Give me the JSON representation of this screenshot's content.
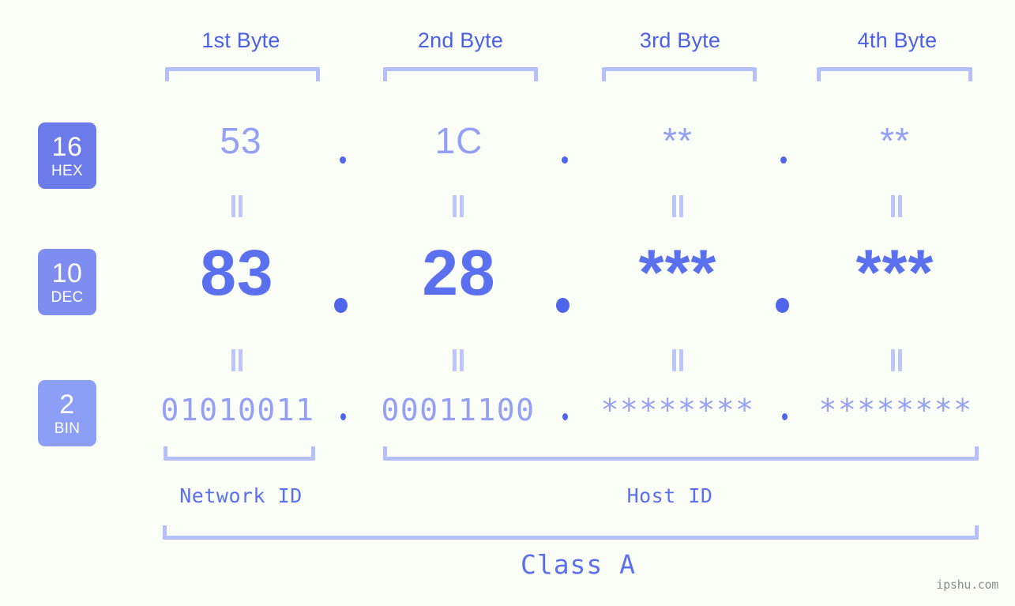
{
  "page": {
    "background_color": "#fbfdf7",
    "watermark": "ipshu.com"
  },
  "colors": {
    "header_blue": "#4b60e8",
    "bracket": "#b4bffb",
    "light_value": "#93a0f6",
    "strong_value": "#5a70ee",
    "badge_hex": "#6d7ae9",
    "badge_dec": "#808df0",
    "badge_bin": "#8c9ef5",
    "dot": "#4f66ec",
    "equals": "#bcc6fb",
    "watermark": "#8c8c8c"
  },
  "byte_headers": [
    {
      "label": "1st Byte"
    },
    {
      "label": "2nd Byte"
    },
    {
      "label": "3rd Byte"
    },
    {
      "label": "4th Byte"
    }
  ],
  "bases": [
    {
      "num": "16",
      "name": "HEX",
      "color": "#6d7ae9"
    },
    {
      "num": "10",
      "name": "DEC",
      "color": "#808df0"
    },
    {
      "num": "2",
      "name": "BIN",
      "color": "#8c9ef5"
    }
  ],
  "rows": {
    "hex": {
      "base_num": "16",
      "base_name": "HEX",
      "octets": [
        "53",
        "1C",
        "**",
        "**"
      ],
      "separator": "."
    },
    "dec": {
      "base_num": "10",
      "base_name": "DEC",
      "octets": [
        "83",
        "28",
        "***",
        "***"
      ],
      "separator": "."
    },
    "bin": {
      "base_num": "2",
      "base_name": "BIN",
      "octets": [
        "01010011",
        "00011100",
        "********",
        "********"
      ],
      "separator": "."
    }
  },
  "equals_symbol": "=",
  "segments": {
    "network_id": "Network ID",
    "host_id": "Host ID",
    "class": "Class A"
  }
}
